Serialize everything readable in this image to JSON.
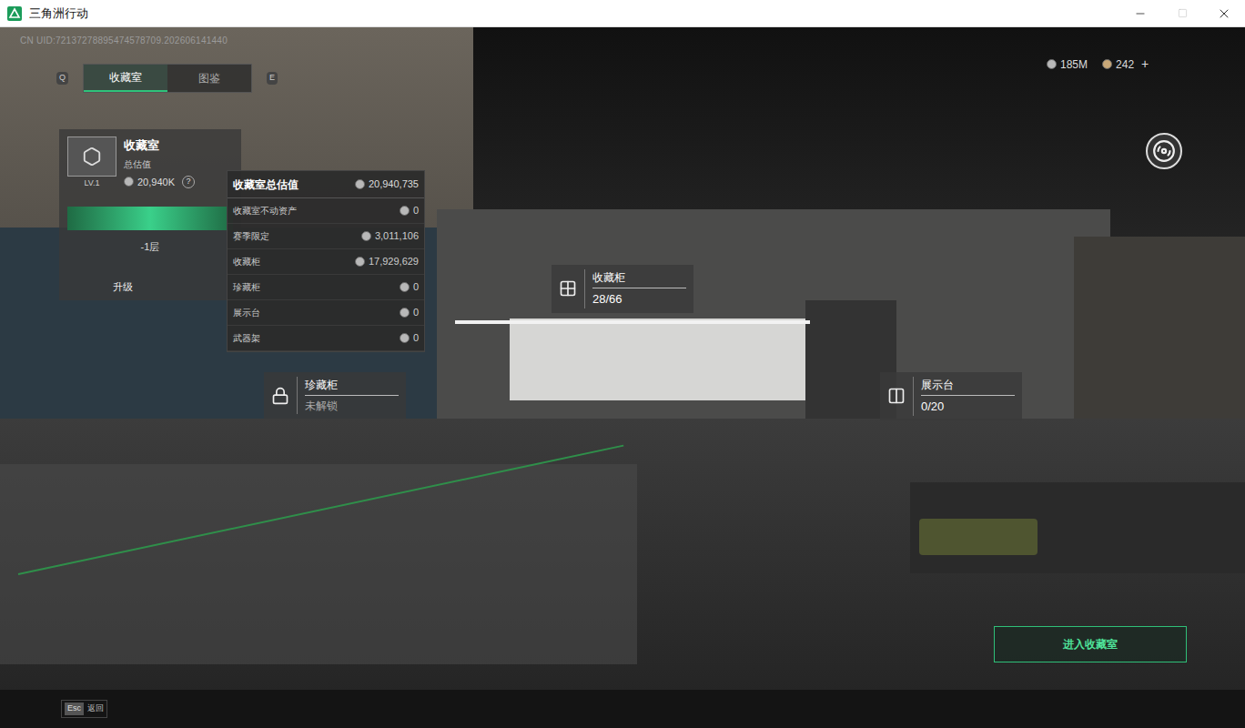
{
  "window": {
    "title": "三角洲行动"
  },
  "uid": "CN UID:72137278895474578709.202606141440",
  "tab_keys": [
    "Q",
    "E"
  ],
  "tabs": [
    {
      "label": "收藏室",
      "selected": true
    },
    {
      "label": "图鉴",
      "selected": false
    }
  ],
  "currencies": [
    {
      "amount": "185M",
      "add": "",
      "color": "#b8b8b8"
    },
    {
      "amount": "242",
      "add": "+",
      "color": "#c9a878"
    }
  ],
  "room_card": {
    "title": "收藏室",
    "subtitle": "总估值",
    "level_label": "LV.1",
    "value": "20,940K",
    "help": "?",
    "progress": 1,
    "floor": "-1层",
    "upgrade": "升级"
  },
  "valuation": {
    "title": "收藏室总估值",
    "total": "20,940,735",
    "rows": [
      {
        "label": "收藏室不动资产",
        "value": "0"
      },
      {
        "label": "赛季限定",
        "value": "3,011,106"
      },
      {
        "label": "收藏柜",
        "value": "17,929,629"
      },
      {
        "label": "珍藏柜",
        "value": "0"
      },
      {
        "label": "展示台",
        "value": "0"
      },
      {
        "label": "武器架",
        "value": "0"
      }
    ]
  },
  "markers": [
    {
      "name": "收藏柜",
      "value": "28/66",
      "locked": false
    },
    {
      "name": "珍藏柜",
      "value": "未解锁",
      "locked": true
    },
    {
      "name": "展示台",
      "value": "0/20",
      "locked": false
    }
  ],
  "enter_button": "进入收藏室",
  "footer": {
    "key": "Esc",
    "label": "返回"
  }
}
